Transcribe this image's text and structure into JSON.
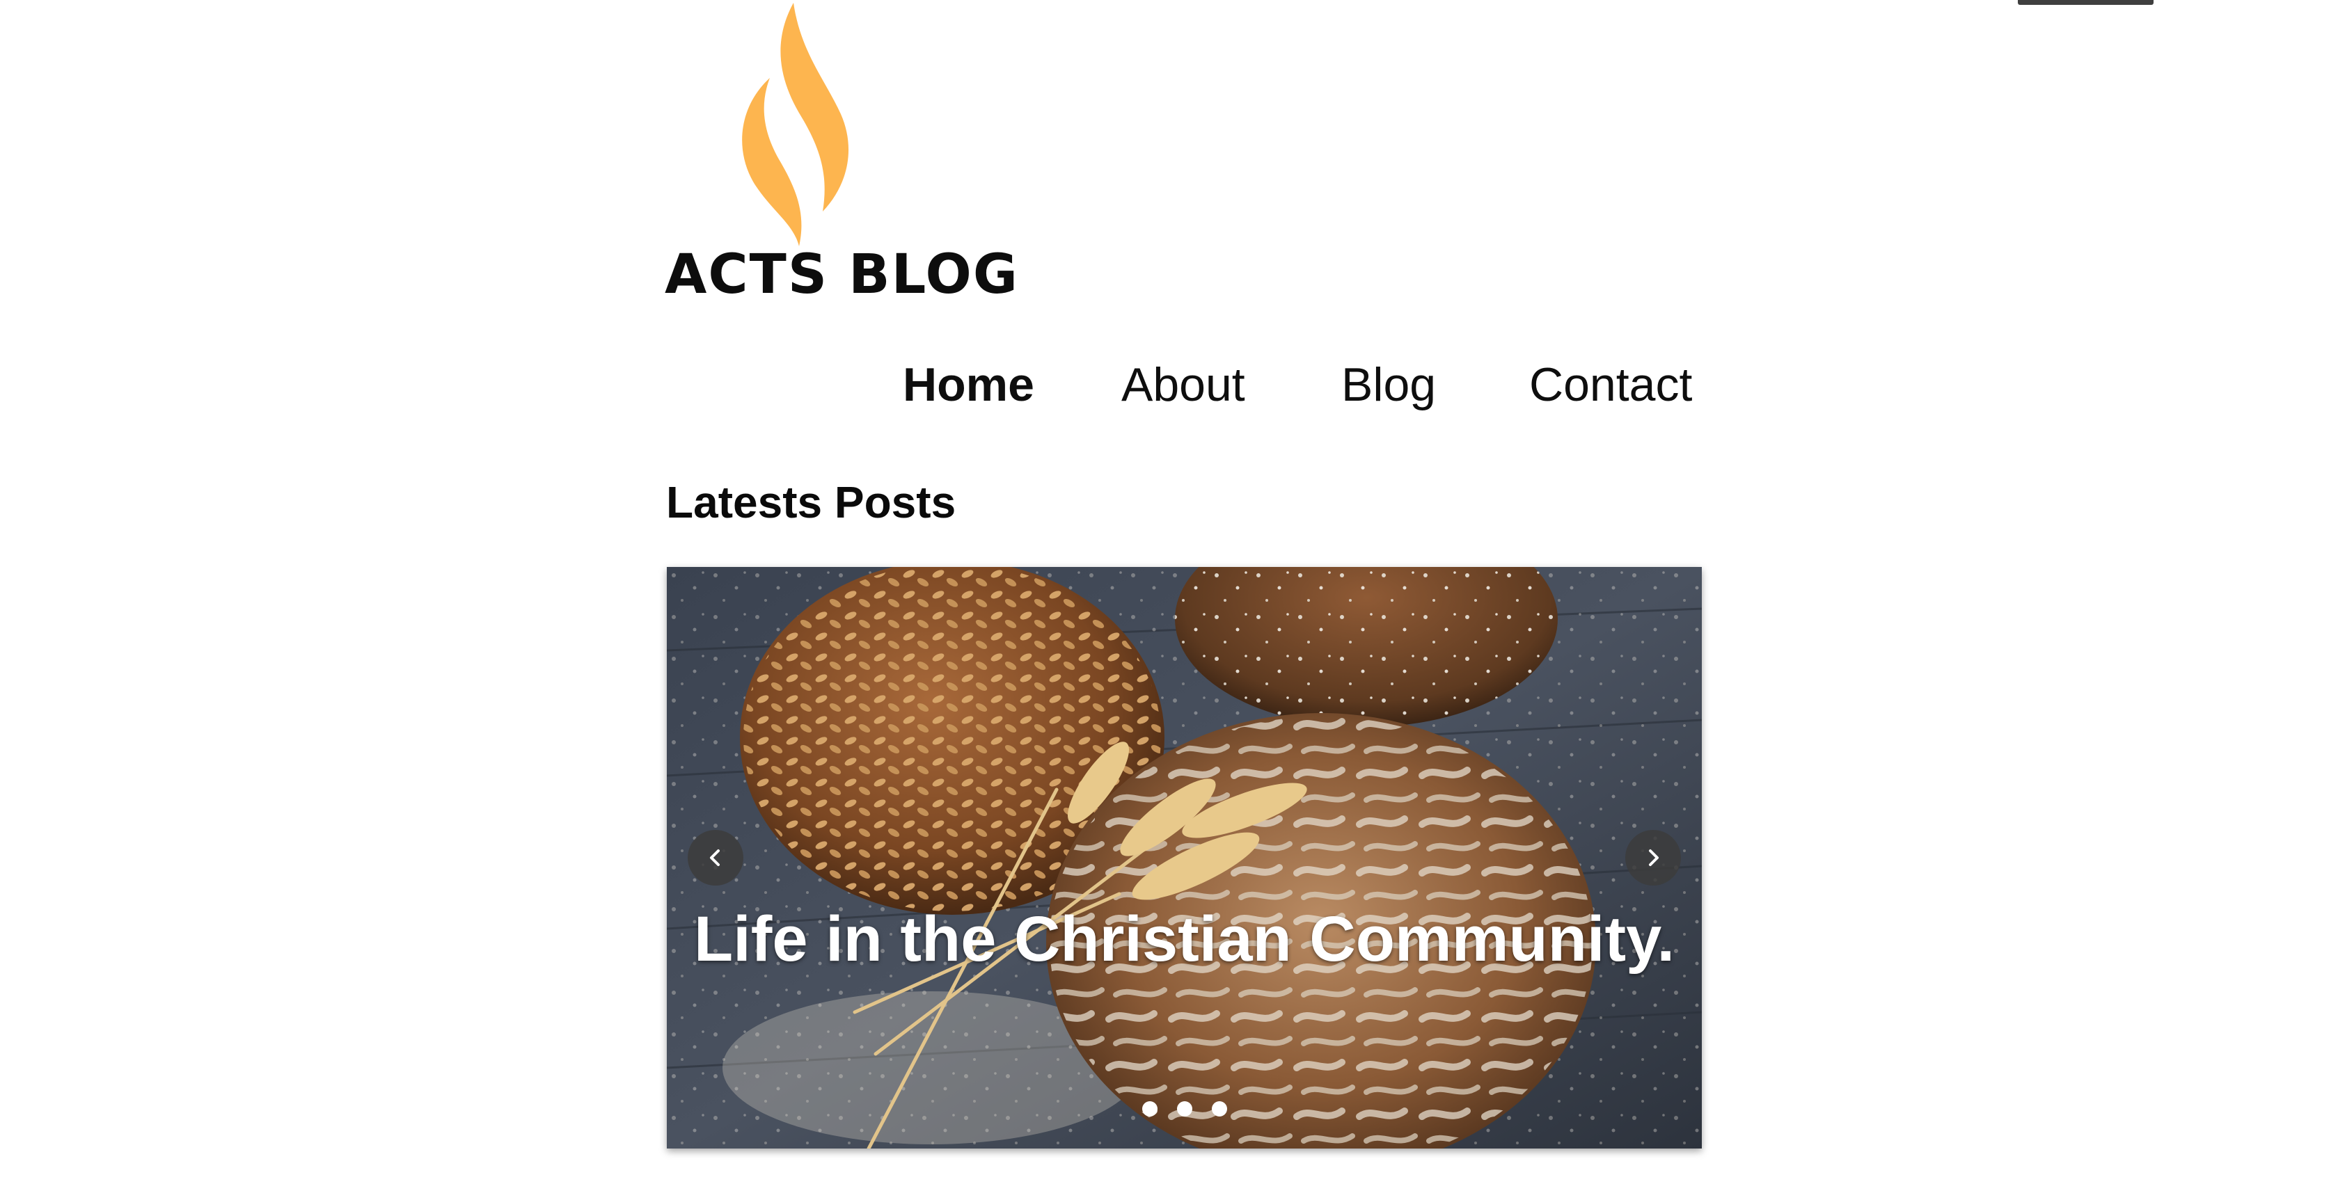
{
  "brand": {
    "name": "ACTS BLOG",
    "flame_color": "#FDB54F"
  },
  "nav": {
    "items": [
      {
        "label": "Home",
        "active": true
      },
      {
        "label": "About",
        "active": false
      },
      {
        "label": "Blog",
        "active": false
      },
      {
        "label": "Contact",
        "active": false
      }
    ]
  },
  "main": {
    "section_title": "Latests Posts",
    "carousel": {
      "caption": "Life in the Christian Community.",
      "prev_icon": "chevron-left-icon",
      "next_icon": "chevron-right-icon",
      "slide_count": 3
    }
  }
}
